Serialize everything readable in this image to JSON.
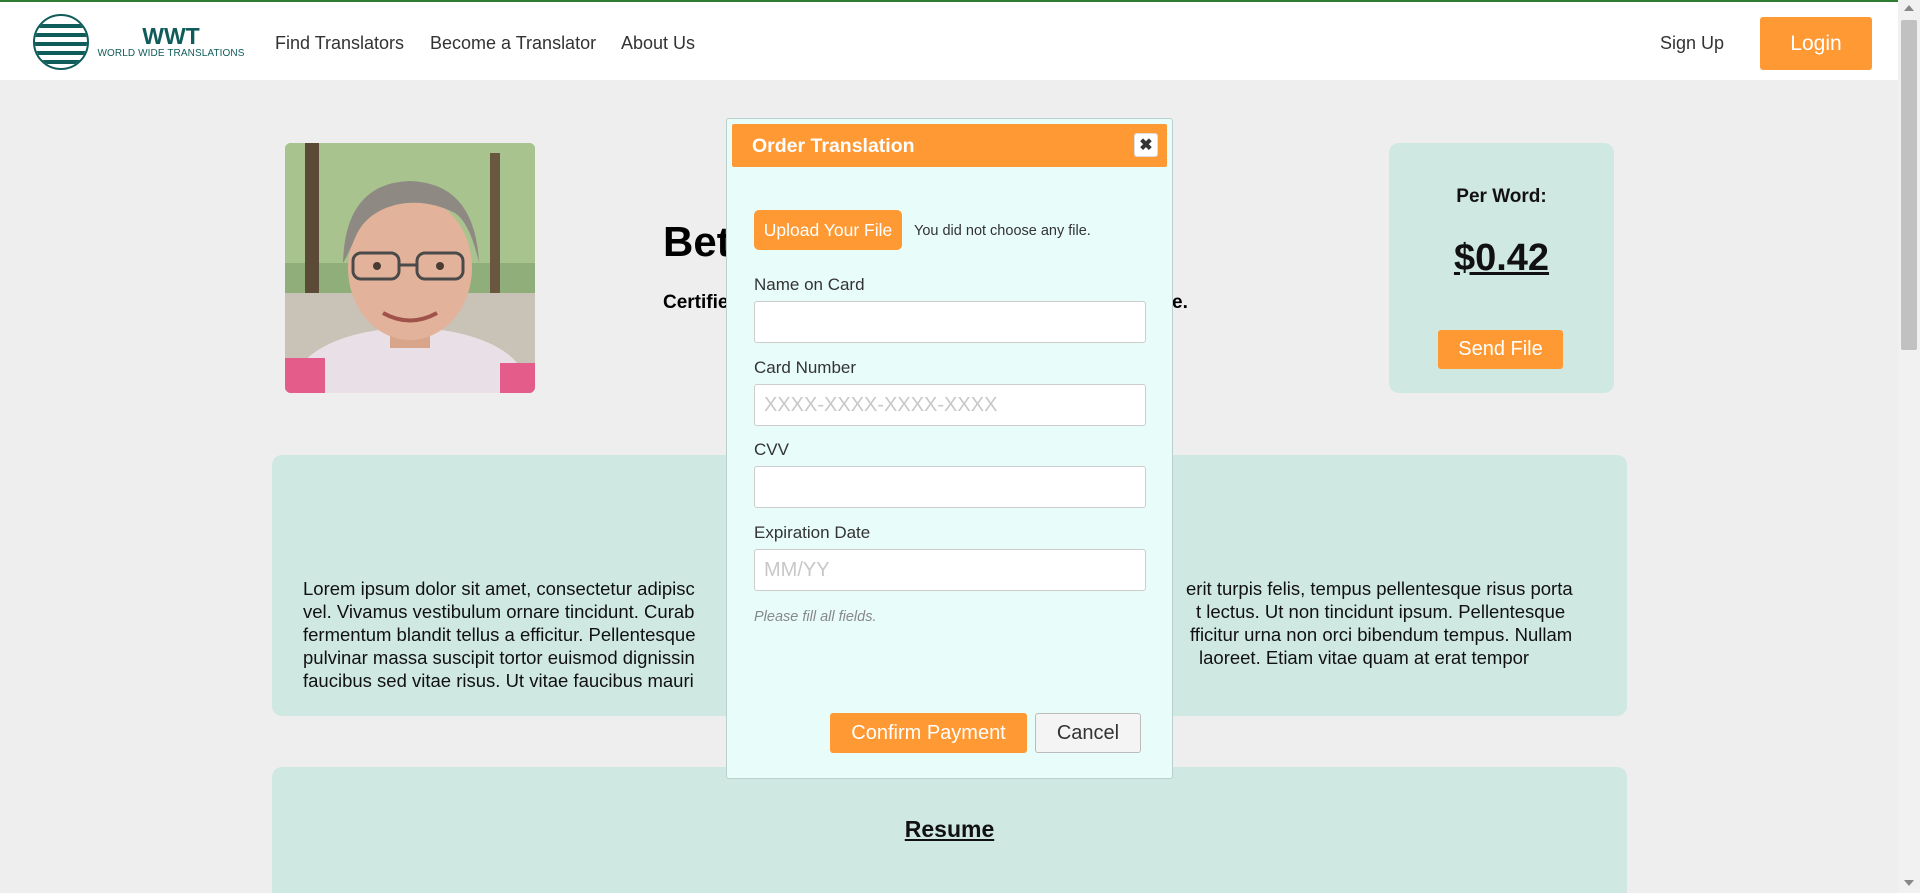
{
  "nav": {
    "brand_title": "WWT",
    "brand_subtitle": "WORLD WIDE TRANSLATIONS",
    "links": [
      "Find Translators",
      "Become a Translator",
      "About Us"
    ],
    "sign_up": "Sign Up",
    "login": "Login"
  },
  "profile": {
    "name_visible": "Bet",
    "subtitle_visible_start": "Certifie",
    "subtitle_visible_end": "e.",
    "price_label": "Per Word:",
    "price_value": "$0.42",
    "send_file": "Send File"
  },
  "about": {
    "lines": [
      {
        "left": "Lorem ipsum dolor sit amet, consectetur adipisc",
        "right": "erit turpis felis, tempus pellentesque risus porta"
      },
      {
        "left": "vel. Vivamus vestibulum ornare tincidunt. Curab",
        "right": "t lectus. Ut non tincidunt ipsum. Pellentesque"
      },
      {
        "left": "fermentum blandit tellus a efficitur. Pellentesque",
        "right": "fficitur urna non orci bibendum tempus. Nullam"
      },
      {
        "left": "pulvinar massa suscipit tortor euismod dignissin",
        "right": "laoreet. Etiam vitae quam at erat tempor"
      },
      {
        "left": "faucibus sed vitae risus. Ut vitae faucibus mauri",
        "right": ""
      }
    ]
  },
  "resume": {
    "title": "Resume"
  },
  "modal": {
    "title": "Order Translation",
    "close": "✖",
    "upload_button": "Upload Your File",
    "file_status": "You did not choose any file.",
    "fields": {
      "name_on_card": {
        "label": "Name on Card",
        "value": "",
        "placeholder": ""
      },
      "card_number": {
        "label": "Card Number",
        "value": "",
        "placeholder": "XXXX-XXXX-XXXX-XXXX"
      },
      "cvv": {
        "label": "CVV",
        "value": "",
        "placeholder": ""
      },
      "expiration": {
        "label": "Expiration Date",
        "value": "",
        "placeholder": "MM/YY"
      }
    },
    "hint": "Please fill all fields.",
    "confirm": "Confirm Payment",
    "cancel": "Cancel"
  },
  "colors": {
    "accent": "#ff9933",
    "brand": "#0f5c5a",
    "card_bg": "#d0e8e2",
    "modal_bg": "#e8fdfa"
  },
  "icons": [
    "globe-logo-icon",
    "close-icon",
    "scroll-up-arrow-icon",
    "scroll-down-arrow-icon"
  ]
}
